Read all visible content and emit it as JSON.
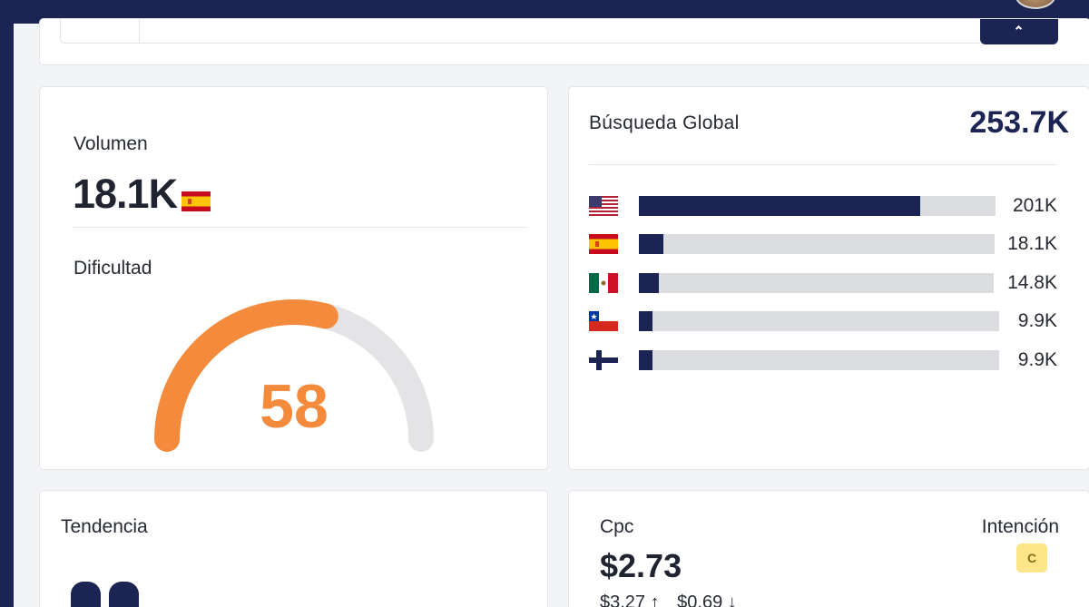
{
  "volume": {
    "label": "Volumen",
    "value": "18.1K",
    "country_flag": "spain-flag"
  },
  "difficulty": {
    "label": "Dificultad",
    "value": "58",
    "score": 58,
    "max": 100,
    "color": "#f48a3c",
    "track_color": "#e4e4e6"
  },
  "global": {
    "label": "Búsqueda Global",
    "value": "253.7K",
    "countries": [
      {
        "flag": "usa-flag",
        "value": "201K",
        "fraction": 0.79
      },
      {
        "flag": "spain-flag",
        "value": "18.1K",
        "fraction": 0.07
      },
      {
        "flag": "mexico-flag",
        "value": "14.8K",
        "fraction": 0.057
      },
      {
        "flag": "chile-flag",
        "value": "9.9K",
        "fraction": 0.038
      },
      {
        "flag": "finland-flag",
        "value": "9.9K",
        "fraction": 0.038
      }
    ],
    "bar_color": "#1c2454",
    "track_color": "#dcdde0"
  },
  "trend": {
    "label": "Tendencia"
  },
  "cpc": {
    "label": "Cpc",
    "value": "$2.73",
    "high": "$3.27 ↑",
    "low": "$0.69 ↓",
    "intent_label": "Intención",
    "intent_badge": "C"
  }
}
